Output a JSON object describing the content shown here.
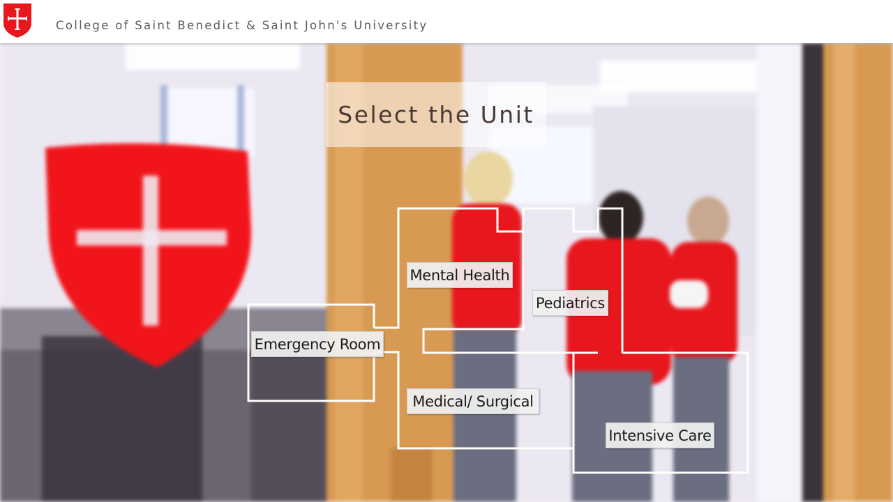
{
  "header": {
    "logo_icon": "red-shield-cross-icon",
    "title": "College of Saint Benedict & Saint John's University"
  },
  "page": {
    "title": "Select the Unit"
  },
  "units": [
    {
      "id": "mental-health",
      "label": "Mental Health"
    },
    {
      "id": "pediatrics",
      "label": "Pediatrics"
    },
    {
      "id": "emergency-room",
      "label": "Emergency Room"
    },
    {
      "id": "medical-surgical",
      "label": "Medical/ Surgical"
    },
    {
      "id": "intensive-care",
      "label": "Intensive Care"
    }
  ],
  "colors": {
    "brand_red": "#e8161d",
    "header_bg": "#ffffff",
    "floorplan_stroke": "#ffffff"
  }
}
